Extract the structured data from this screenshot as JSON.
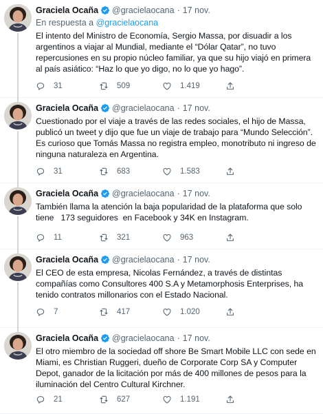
{
  "author": {
    "name": "Graciela Ocaña",
    "handle": "@gracielaocana",
    "date": "17 nov."
  },
  "colors": {
    "verified": "#1d9bf0",
    "mention": "#1d9bf0",
    "muted": "#536471"
  },
  "tweets": [
    {
      "reply_prefix": "En respuesta a",
      "reply_mention": "@gracielaocana",
      "lines": [
        "El intento del Ministro de Economía, Sergio Massa, por disuadir a los",
        "argentinos a viajar al Mundial, mediante el “Dólar Qatar”, no tuvo",
        "repercusiones en su propio núcleo familiar, ya que su hijo viajó en primera",
        "al país asiático: “Haz lo que yo digo, no lo que yo hago”."
      ],
      "replies": "31",
      "retweets": "509",
      "likes": "1.419"
    },
    {
      "lines": [
        "Cuestionado por el viaje a través de las redes sociales, el hijo de Massa,",
        "publicó un tweet y dijo que fue un viaje de trabajo para “Mundo Selección”.",
        "Es curioso que Tomás Massa no registra empleo, monotributo ni ingreso de",
        "ninguna naturaleza en Argentina."
      ],
      "replies": "31",
      "retweets": "683",
      "likes": "1.583"
    },
    {
      "lines": [
        "También llama la atención la baja popularidad de la plataforma que solo",
        "tiene   173 seguidores  en Facebook y 34K en Instagram."
      ],
      "replies": "11",
      "retweets": "321",
      "likes": "963"
    },
    {
      "lines": [
        "El CEO de esta empresa, Nicolas Fernández, a través de distintas",
        "compañías como Consultores 400 S.A y Metamorphosis Enterprises, ha",
        "tenido contratos millonarios con el Estado Nacional."
      ],
      "replies": "7",
      "retweets": "417",
      "likes": "1.020"
    },
    {
      "lines": [
        "El otro miembro de la sociedad off shore Be Smart Mobile LLC con sede en",
        "Miami, es Christian Ruggeri, dueño de Corporate Corp SA y Computer",
        "Depot, ganador de la licitación por más de 400 millones de pesos para la",
        "iluminación del Centro Cultural Kirchner."
      ],
      "replies": "21",
      "retweets": "627",
      "likes": "1.191"
    }
  ]
}
